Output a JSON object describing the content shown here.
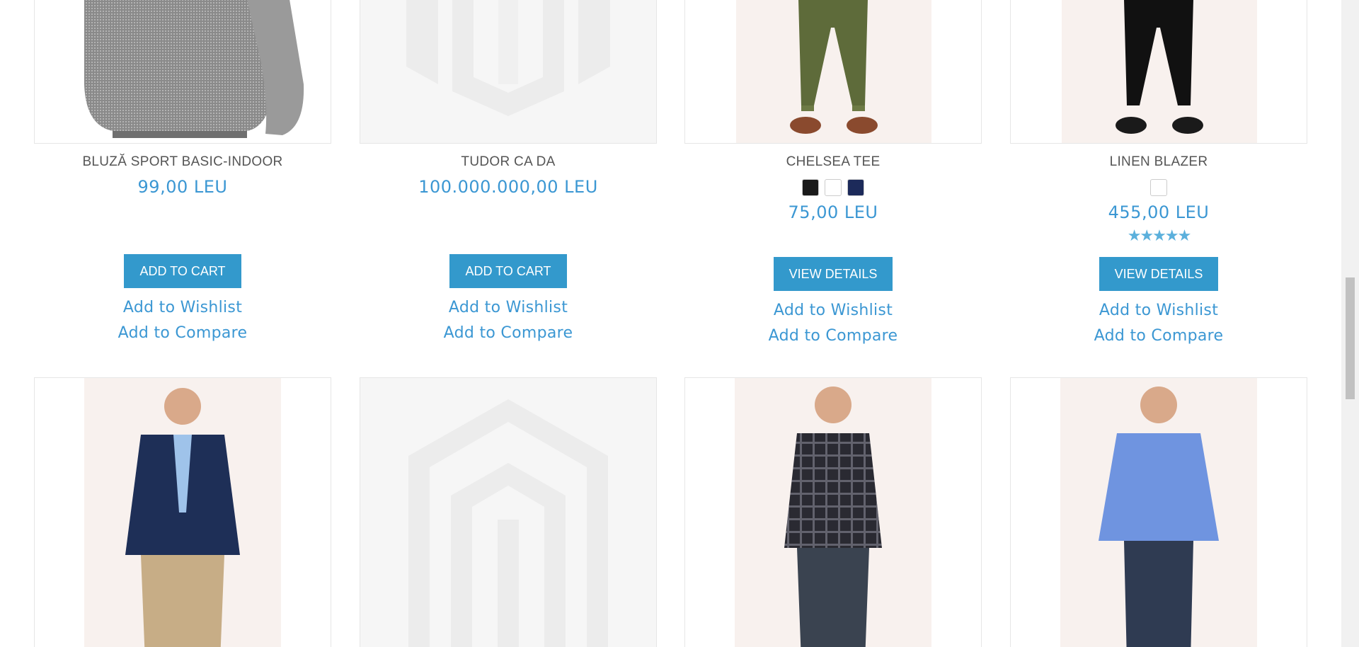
{
  "row1": [
    {
      "name": "BLUZĂ SPORT BASIC-INDOOR",
      "price": "99,00 LEU",
      "button": "ADD TO CART",
      "wishlist": "Add to Wishlist",
      "compare": "Add to Compare",
      "image": "grey-sweater-photo"
    },
    {
      "name": "TUDOR CA DA",
      "price": "100.000.000,00 LEU",
      "button": "ADD TO CART",
      "wishlist": "Add to Wishlist",
      "compare": "Add to Compare",
      "image": "placeholder-logo"
    },
    {
      "name": "CHELSEA TEE",
      "swatches": [
        "#1a1a1a",
        "#ffffff",
        "#1c2a5a"
      ],
      "price": "75,00 LEU",
      "button": "VIEW DETAILS",
      "wishlist": "Add to Wishlist",
      "compare": "Add to Compare",
      "image": "olive-pants-photo"
    },
    {
      "name": "LINEN BLAZER",
      "swatches": [
        "#ffffff"
      ],
      "price": "455,00 LEU",
      "rating": "5 of 5 stars",
      "rating_value": 5,
      "button": "VIEW DETAILS",
      "wishlist": "Add to Wishlist",
      "compare": "Add to Compare",
      "image": "black-pants-photo"
    }
  ],
  "row2": [
    {
      "image": "navy-blazer-photo"
    },
    {
      "image": "placeholder-logo"
    },
    {
      "image": "plaid-shirt-photo"
    },
    {
      "image": "blue-shirt-photo"
    }
  ],
  "colors": {
    "accent": "#3399cc",
    "price": "#3b97d3",
    "name": "#555555"
  }
}
